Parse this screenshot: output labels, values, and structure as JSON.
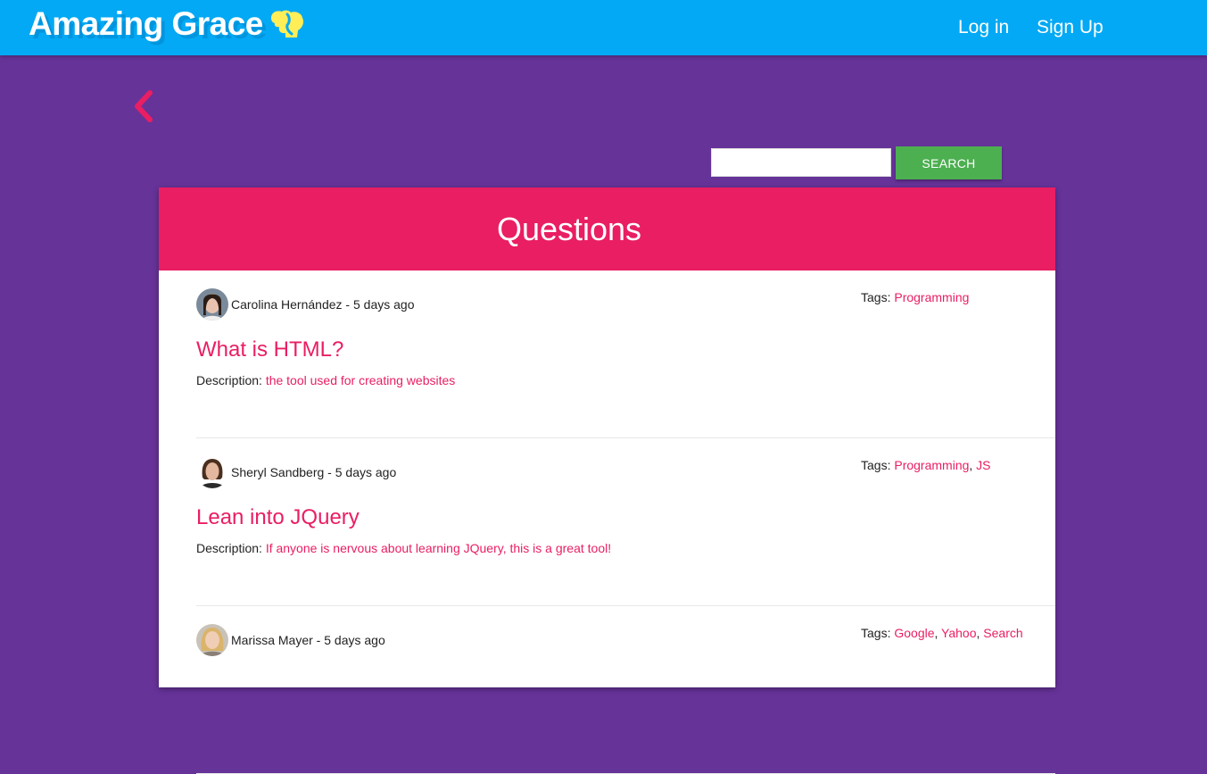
{
  "nav": {
    "brand": "Amazing Grace",
    "login": "Log in",
    "signup": "Sign Up"
  },
  "colors": {
    "navbar": "#03a9f4",
    "background": "#663399",
    "accent": "#e91e63",
    "search_button": "#4caf50",
    "brand_icon": "#ffee58"
  },
  "icons": {
    "brand": "face-silhouette-icon",
    "back": "chevron-left-icon"
  },
  "search": {
    "value": "",
    "button_label": "SEARCH"
  },
  "questions_title": "Questions",
  "labels": {
    "tags": "Tags:",
    "description": "Description:"
  },
  "questions": [
    {
      "author": "Carolina Hernández",
      "time": "5 days ago",
      "title": "What is HTML?",
      "description": "the tool used for creating websites",
      "tags": [
        "Programming"
      ]
    },
    {
      "author": "Sheryl Sandberg",
      "time": "5 days ago",
      "title": "Lean into JQuery",
      "description": "If anyone is nervous about learning JQuery, this is a great tool!",
      "tags": [
        "Programming",
        "JS"
      ]
    },
    {
      "author": "Marissa Mayer",
      "time": "5 days ago",
      "title": "",
      "description": "",
      "tags": [
        "Google",
        "Yahoo",
        "Search"
      ]
    }
  ]
}
